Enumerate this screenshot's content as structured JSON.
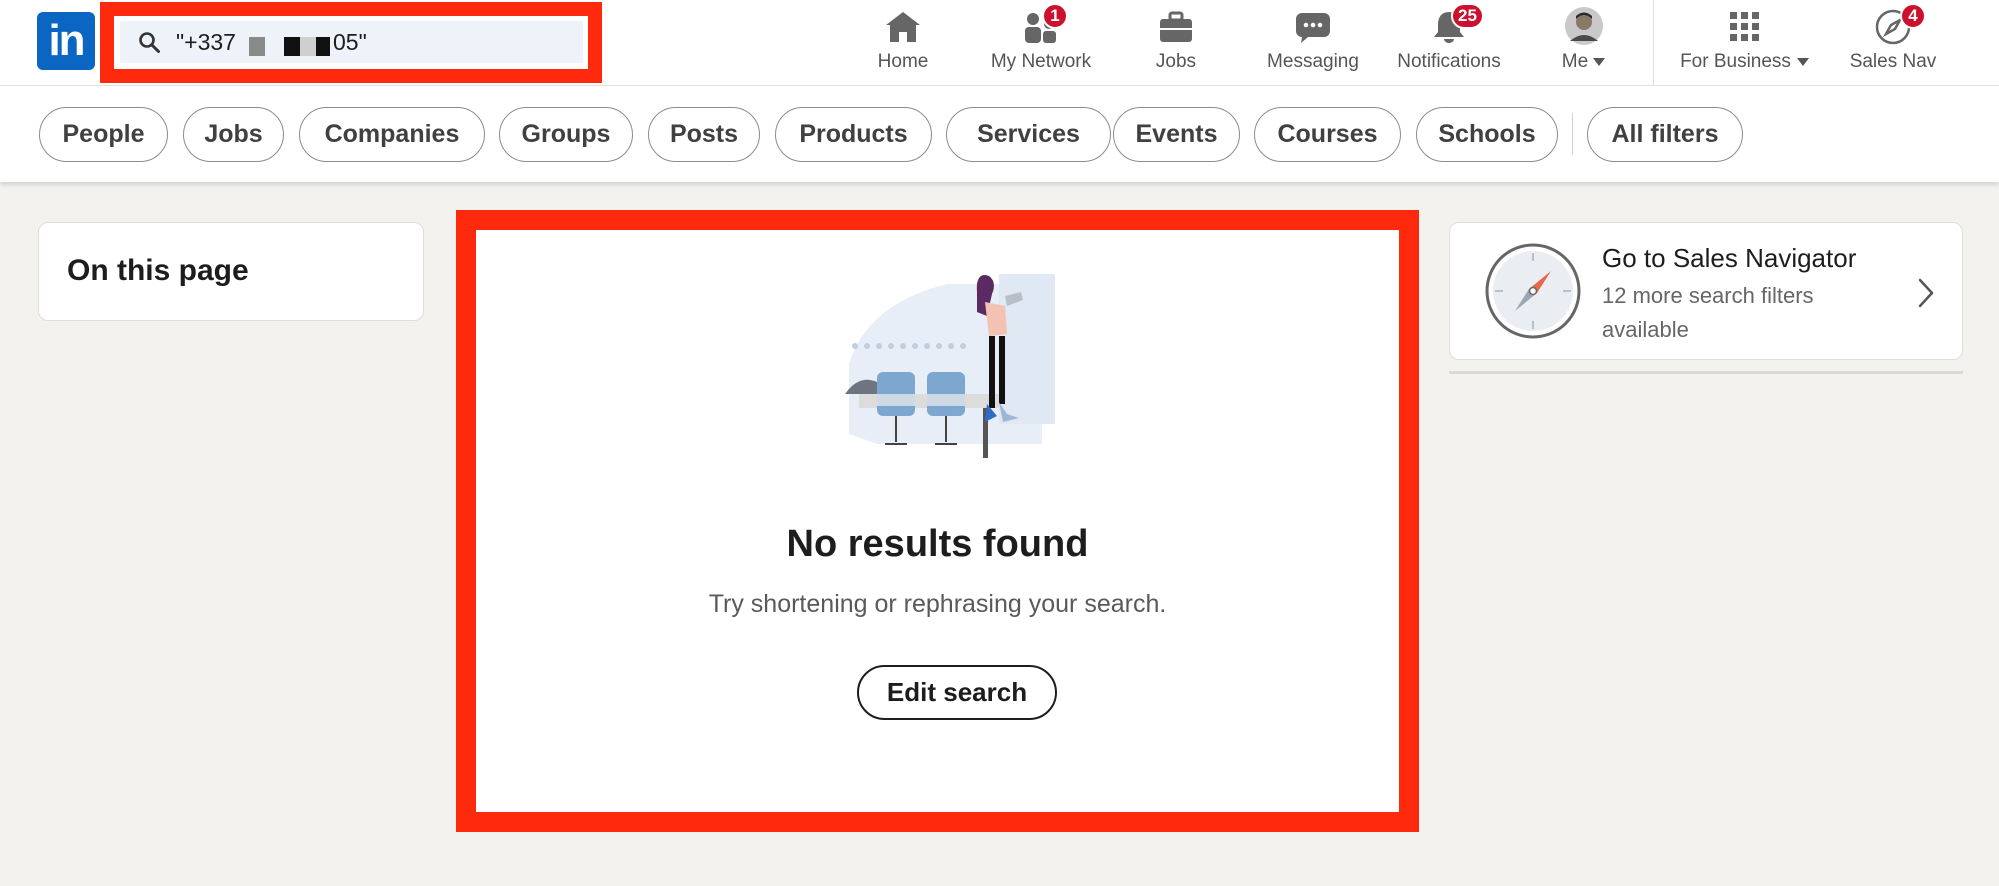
{
  "brand": {
    "logo_text": "in",
    "accent": "#0a66c2",
    "highlight": "#ff2a0d",
    "badge_color": "#cb112d"
  },
  "search": {
    "value": "\"+337",
    "value_end": "05\"",
    "icon": "search-icon"
  },
  "nav": {
    "home": {
      "label": "Home",
      "icon": "home-icon"
    },
    "network": {
      "label": "My Network",
      "icon": "people-icon",
      "badge": "1"
    },
    "jobs": {
      "label": "Jobs",
      "icon": "briefcase-icon"
    },
    "messaging": {
      "label": "Messaging",
      "icon": "chat-bubble-icon"
    },
    "notifications": {
      "label": "Notifications",
      "icon": "bell-icon",
      "badge": "25"
    },
    "me": {
      "label": "Me",
      "icon": "avatar"
    },
    "business": {
      "label": "For Business",
      "icon": "grid-icon"
    },
    "salesnav": {
      "label": "Sales Nav",
      "icon": "compass-icon",
      "badge": "4"
    }
  },
  "filters": [
    "People",
    "Jobs",
    "Companies",
    "Groups",
    "Posts",
    "Products",
    "Services",
    "Events",
    "Courses",
    "Schools",
    "All filters"
  ],
  "left": {
    "title": "On this page"
  },
  "results": {
    "title": "No results found",
    "subtitle": "Try shortening or rephrasing your search.",
    "button": "Edit search"
  },
  "right": {
    "title": "Go to Sales Navigator",
    "subtitle": "12 more search filters available"
  }
}
